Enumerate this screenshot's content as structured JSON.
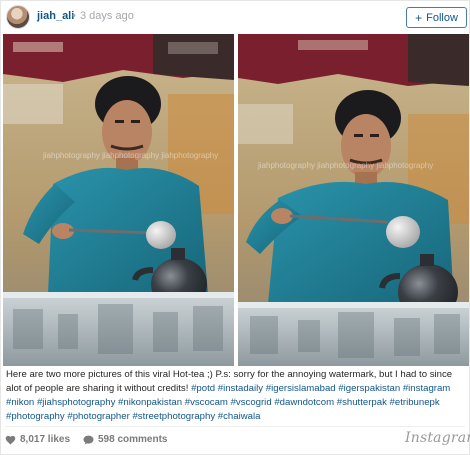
{
  "post": {
    "username": "jiah_ali",
    "separator": "•",
    "timestamp": "3 days ago",
    "follow_label": "Follow",
    "follow_icon": "plus-icon"
  },
  "photo": {
    "panels": [
      {
        "watermark": "jiahphotography jiahphotography jiahphotography"
      },
      {
        "watermark": "jiahphotography jiahphotography jiahphotography"
      }
    ],
    "colors": {
      "shirt": "#1f7f96",
      "banner": "#7a1f2e",
      "kettle": "#2b2f33",
      "skin": "#b98463"
    }
  },
  "caption": {
    "text": "Here are two more pictures of this viral Hot-tea ;) P.s: sorry for the annoying watermark, but I had to since alot of people are sharing it without credits!",
    "hashtags": [
      "#potd",
      "#instadaily",
      "#igersislamabad",
      "#igerspakistan",
      "#instagram",
      "#nikon",
      "#jiahsphotography",
      "#nikonpakistan",
      "#vscocam",
      "#vscogrid",
      "#dawndotcom",
      "#shutterpak",
      "#etribunepk",
      "#photography",
      "#photographer",
      "#streetphotography",
      "#chaiwala"
    ]
  },
  "footer": {
    "likes": "8,017 likes",
    "comments": "598 comments",
    "brand": "Instagram",
    "like_icon": "heart-icon",
    "comment_icon": "comment-icon"
  }
}
